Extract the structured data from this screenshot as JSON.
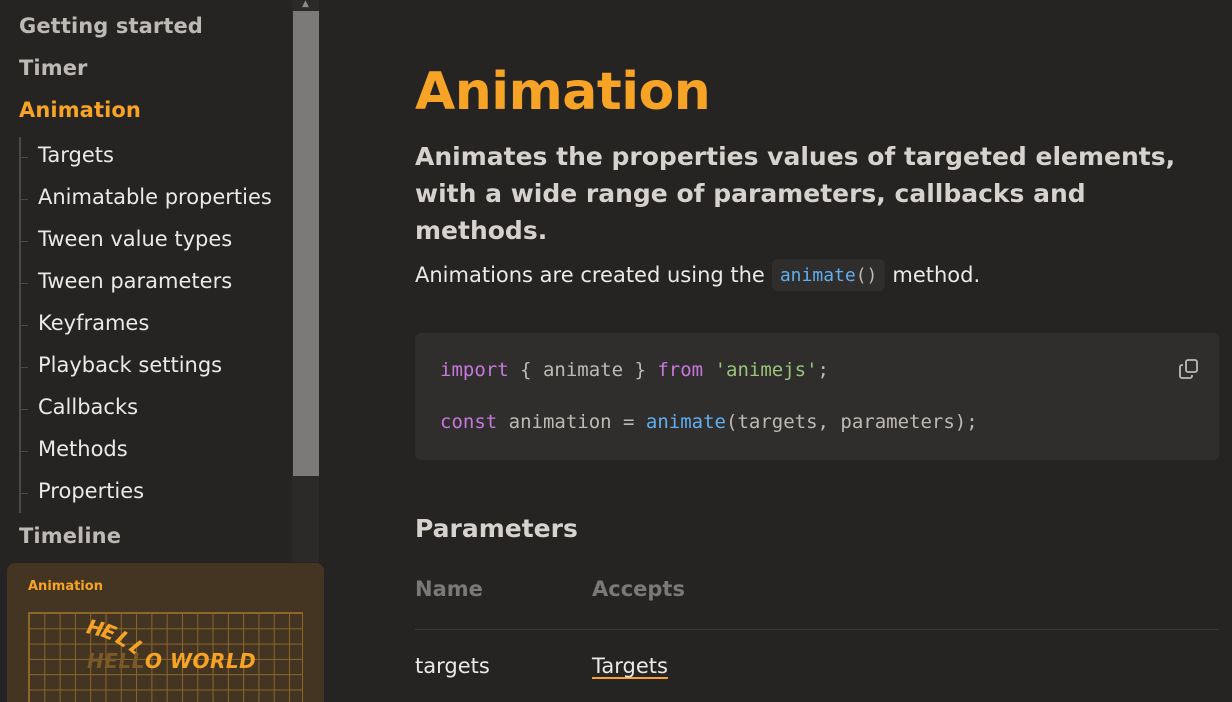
{
  "sidebar": {
    "items_top": [
      {
        "label": "Getting started"
      },
      {
        "label": "Timer"
      },
      {
        "label": "Animation"
      }
    ],
    "animation_children": [
      {
        "label": "Targets"
      },
      {
        "label": "Animatable properties"
      },
      {
        "label": "Tween value types"
      },
      {
        "label": "Tween parameters"
      },
      {
        "label": "Keyframes"
      },
      {
        "label": "Playback settings"
      },
      {
        "label": "Callbacks"
      },
      {
        "label": "Methods"
      },
      {
        "label": "Properties"
      }
    ],
    "items_bottom": [
      {
        "label": "Timeline"
      }
    ],
    "active_item": "Animation",
    "preview_card": {
      "label": "Animation",
      "demo_text_arc": "HELL",
      "demo_text_dim": "HELL",
      "demo_text_bright": "O WORLD"
    }
  },
  "main": {
    "title": "Animation",
    "lead": "Animates the properties values of targeted elements, with a wide range of parameters, callbacks and methods.",
    "intro_before": "Animations are created using the",
    "intro_code_fn": "animate",
    "intro_code_parens": "()",
    "intro_after": "method.",
    "code": {
      "line1": {
        "kw1": "import",
        "mid": " { animate } ",
        "kw2": "from",
        "space": " ",
        "str": "'animejs'",
        "end": ";"
      },
      "line2": {
        "kw": "const",
        "mid": " animation = ",
        "fn": "animate",
        "end": "(targets, parameters);"
      }
    },
    "parameters": {
      "title": "Parameters",
      "columns": [
        "Name",
        "Accepts"
      ],
      "rows": [
        {
          "name": "targets",
          "accepts": "Targets"
        }
      ]
    }
  },
  "colors": {
    "accent": "#f7a325",
    "background": "#252423",
    "code_bg": "#2f2e2d",
    "keyword": "#c678dd",
    "string": "#98c379",
    "function": "#61aeee"
  },
  "icons": {
    "copy": "copy-icon",
    "scroll_up": "scroll-up-arrow-icon"
  }
}
